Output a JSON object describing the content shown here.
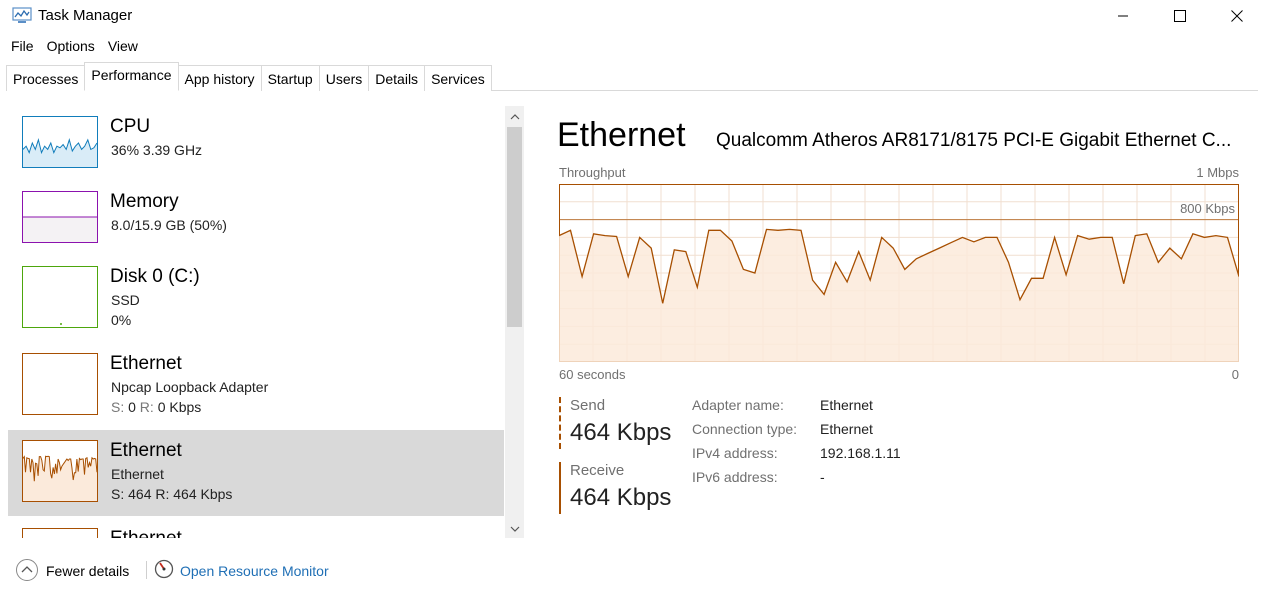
{
  "window": {
    "title": "Task Manager",
    "icons": {
      "app": "task-manager-icon",
      "minimize": "minimize-icon",
      "maximize": "maximize-icon",
      "close": "close-icon"
    }
  },
  "menu": [
    "File",
    "Options",
    "View"
  ],
  "tabs": [
    {
      "label": "Processes",
      "active": false
    },
    {
      "label": "Performance",
      "active": true
    },
    {
      "label": "App history",
      "active": false
    },
    {
      "label": "Startup",
      "active": false
    },
    {
      "label": "Users",
      "active": false
    },
    {
      "label": "Details",
      "active": false
    },
    {
      "label": "Services",
      "active": false
    }
  ],
  "resources": [
    {
      "name": "CPU",
      "line1": "36%  3.39 GHz",
      "line2": "",
      "color": "#117dbb",
      "selected": false,
      "samples": [
        0.3,
        0.4,
        0.2,
        0.5,
        0.3,
        0.6,
        0.2,
        0.4,
        0.3,
        0.5,
        0.2,
        0.4,
        0.35,
        0.45,
        0.3,
        0.6,
        0.25,
        0.4,
        0.5,
        0.3,
        0.4,
        0.6,
        0.3,
        0.35,
        0.5
      ]
    },
    {
      "name": "Memory",
      "line1": "8.0/15.9 GB (50%)",
      "line2": "",
      "color": "#8b12ae",
      "selected": false,
      "fill": 0.5
    },
    {
      "name": "Disk 0 (C:)",
      "line1": "SSD",
      "line2": "0%",
      "color": "#4da60c",
      "selected": false
    },
    {
      "name": "Ethernet",
      "line1": "Npcap Loopback Adapter",
      "line2_s": "S: ",
      "line2_sv": "0",
      "line2_r": " R: ",
      "line2_rv": "0 Kbps",
      "color": "#a74f01",
      "selected": false
    },
    {
      "name": "Ethernet",
      "line1": "Ethernet",
      "line2": "S: 464  R: 464 Kbps",
      "color": "#a74f01",
      "selected": true
    },
    {
      "name": "Ethernet",
      "line1": "",
      "line2": "",
      "color": "#a74f01",
      "selected": false
    }
  ],
  "detail": {
    "title": "Ethernet",
    "adapter": "Qualcomm Atheros AR8171/8175 PCI-E Gigabit Ethernet C...",
    "graph": {
      "label_left": "Throughput",
      "label_right": "1 Mbps",
      "scale_label": "800 Kbps",
      "time_left": "60 seconds",
      "time_right": "0",
      "max_kbps": 1000,
      "scale_kbps": 800,
      "color": "#a74f01",
      "samples": [
        710,
        740,
        480,
        720,
        710,
        705,
        480,
        700,
        640,
        330,
        630,
        620,
        420,
        740,
        740,
        680,
        520,
        500,
        745,
        740,
        745,
        740,
        460,
        380,
        560,
        450,
        620,
        460,
        700,
        640,
        520,
        580,
        610,
        640,
        670,
        700,
        675,
        700,
        700,
        560,
        350,
        470,
        470,
        700,
        490,
        710,
        690,
        700,
        700,
        440,
        710,
        720,
        560,
        640,
        580,
        720,
        700,
        710,
        700,
        480
      ]
    },
    "send": {
      "label": "Send",
      "value": "464 Kbps"
    },
    "receive": {
      "label": "Receive",
      "value": "464 Kbps"
    },
    "props": [
      {
        "k": "Adapter name:",
        "v": "Ethernet"
      },
      {
        "k": "Connection type:",
        "v": "Ethernet"
      },
      {
        "k": "IPv4 address:",
        "v": "192.168.1.11"
      },
      {
        "k": "IPv6 address:",
        "v": "-"
      }
    ]
  },
  "footer": {
    "fewer_details": "Fewer details",
    "open_resource_monitor": "Open Resource Monitor"
  }
}
